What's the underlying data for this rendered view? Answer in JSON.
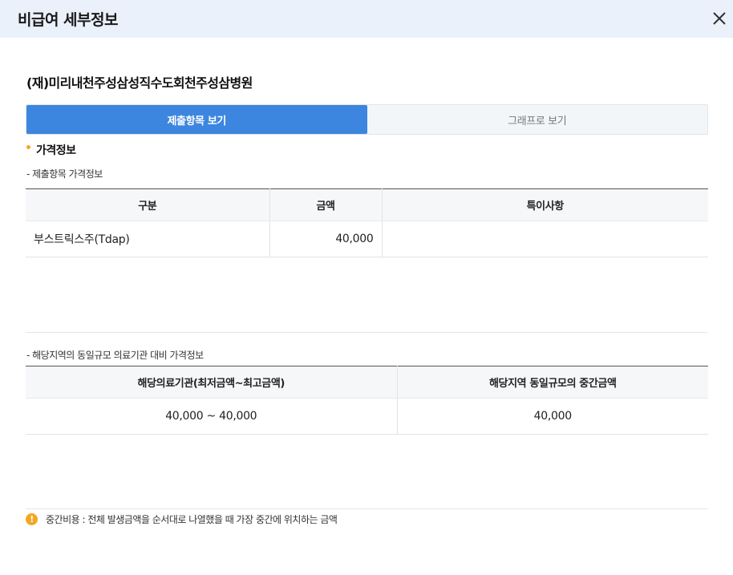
{
  "header": {
    "title": "비급여 세부정보",
    "close_icon": "close-icon"
  },
  "hospital": {
    "name": "(재)미리내천주성삼성직수도회천주성삼병원"
  },
  "tabs": [
    {
      "label": "제출항목 보기",
      "active": true
    },
    {
      "label": "그래프로 보기",
      "active": false
    }
  ],
  "price_info": {
    "title": "가격정보",
    "submitted": {
      "subtitle": "- 제출항목 가격정보",
      "columns": [
        "구분",
        "금액",
        "특이사항"
      ],
      "rows": [
        {
          "category": "부스트릭스주(Tdap)",
          "amount": "40,000",
          "remark": ""
        }
      ]
    },
    "regional": {
      "subtitle": "- 해당지역의 동일규모 의료기관 대비 가격정보",
      "columns": [
        "해당의료기관(최저금액~최고금액)",
        "해당지역 동일규모의 중간금액"
      ],
      "rows": [
        {
          "range": "40,000 ~ 40,000",
          "median": "40,000"
        }
      ]
    }
  },
  "note": {
    "icon_label": "!",
    "text": "중간비용 : 전체 발생금액을 순서대로 나열했을 때 가장 중간에 위치하는 금액"
  },
  "colors": {
    "accent": "#3d86df",
    "header_bg": "#eaf1fb",
    "bullet": "#f5a623"
  }
}
